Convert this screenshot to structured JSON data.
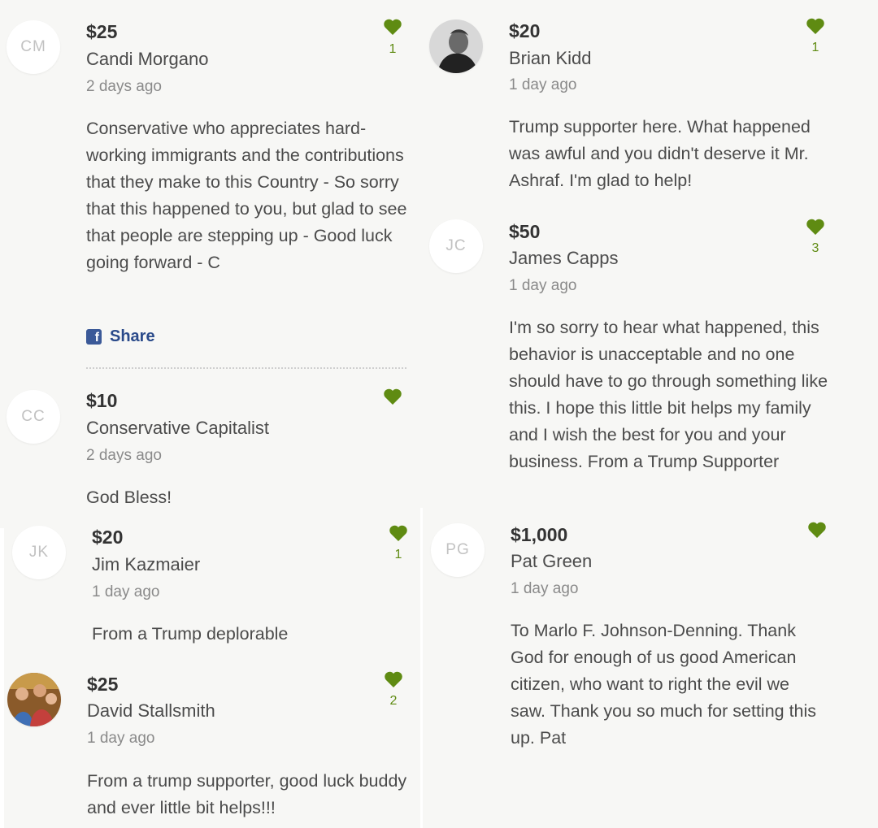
{
  "colors": {
    "heart": "#5f8b12",
    "share": "#3b5998"
  },
  "donations": [
    {
      "id": "cm",
      "initials": "CM",
      "amount": "$25",
      "name": "Candi Morgano",
      "time": "2 days ago",
      "message": "Conservative who appreciates hard-working immigrants and the contributions that they make to this Country - So sorry that this happened to you, but glad to see that people are stepping up - Good luck going forward - C",
      "likes": "1"
    },
    {
      "id": "bk",
      "initials": "",
      "amount": "$20",
      "name": "Brian Kidd",
      "time": "1 day ago",
      "message": "Trump supporter here. What happened was awful and you didn't deserve it Mr. Ashraf. I'm glad to help!",
      "likes": "1"
    },
    {
      "id": "jc",
      "initials": "JC",
      "amount": "$50",
      "name": "James Capps",
      "time": "1 day ago",
      "message": "I'm so sorry to hear what happened, this behavior is unacceptable and no one should have to go through something like this. I hope this little bit helps my family and I wish the best for you and your business. From a Trump Supporter",
      "likes": "3"
    },
    {
      "id": "cc",
      "initials": "CC",
      "amount": "$10",
      "name": "Conservative Capitalist",
      "time": "2 days ago",
      "message": "God Bless!",
      "likes": ""
    },
    {
      "id": "pg",
      "initials": "PG",
      "amount": "$1,000",
      "name": "Pat Green",
      "time": "1 day ago",
      "message": "To Marlo F. Johnson-Denning. Thank God for enough of us good American citizen, who want to right the evil we saw. Thank you so much for setting this up. Pat",
      "likes": ""
    },
    {
      "id": "jk",
      "initials": "JK",
      "amount": "$20",
      "name": "Jim Kazmaier",
      "time": "1 day ago",
      "message": "From a Trump deplorable",
      "likes": "1"
    },
    {
      "id": "ds",
      "initials": "",
      "amount": "$25",
      "name": "David Stallsmith",
      "time": "1 day ago",
      "message": "From a trump supporter, good luck buddy and ever little bit helps!!!",
      "likes": "2"
    }
  ],
  "share": {
    "label": "Share",
    "icon": "facebook-icon"
  }
}
